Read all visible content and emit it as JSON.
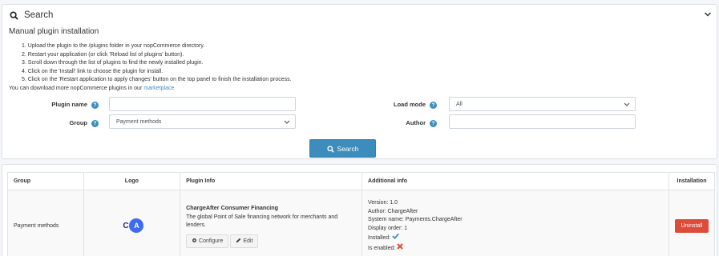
{
  "search": {
    "title": "Search",
    "manual_title": "Manual plugin installation",
    "steps": [
      "1. Upload the plugin to the /plugins folder in your nopCommerce directory.",
      "2. Restart your application (or click 'Reload list of plugins' button).",
      "3. Scroll down through the list of plugins to find the newly installed plugin.",
      "4. Click on the 'Install' link to choose the plugin for install.",
      "5. Click on the 'Restart application to apply changes' button on the top panel to finish the installation process."
    ],
    "download_text": "You can download more nopCommerce plugins in our",
    "download_link": "marketplace",
    "plugin_name_label": "Plugin name",
    "plugin_name_value": "",
    "group_label": "Group",
    "group_value": "Payment methods",
    "load_mode_label": "Load mode",
    "load_mode_value": "All",
    "author_label": "Author",
    "author_value": "",
    "search_button": "Search"
  },
  "table": {
    "headers": [
      "Group",
      "Logo",
      "Plugin Info",
      "Additional info",
      "Installation"
    ],
    "rows": [
      {
        "group": "Payment methods",
        "logo_letters": [
          "C",
          "A"
        ],
        "name": "ChargeAfter Consumer Financing",
        "description": "The global Point of Sale financing network for merchants and lenders.",
        "configure": "Configure",
        "edit": "Edit",
        "version": "Version: 1.0",
        "author": "Author: ChargeAfter",
        "system_name": "System name: Payments.ChargeAfter",
        "display_order": "Display order: 1",
        "installed": "Installed:",
        "enabled": "Is enabled:",
        "uninstall": "Uninstall"
      }
    ]
  },
  "colors": {
    "accent": "#3c8dbc",
    "danger": "#dd4b39",
    "brand_logo": "#3d6cf2"
  }
}
